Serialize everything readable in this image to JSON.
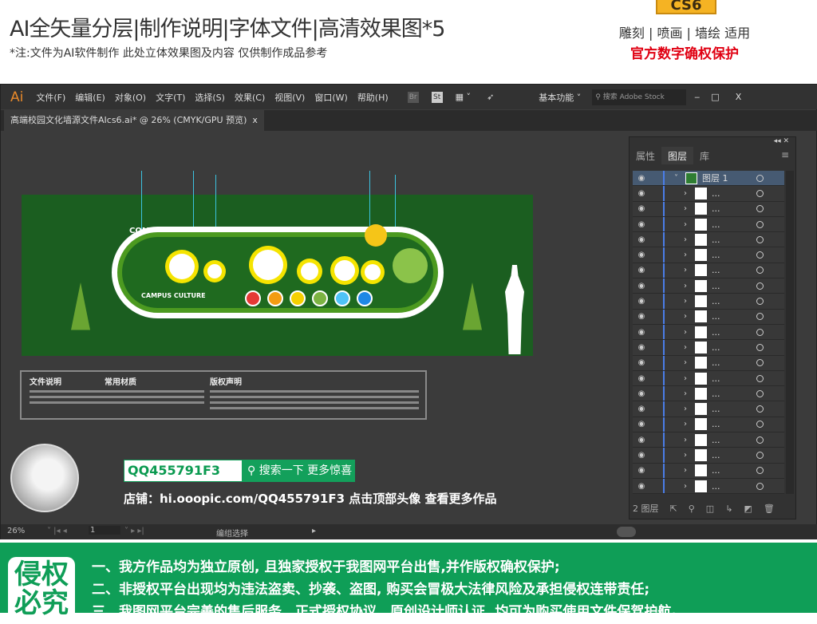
{
  "header": {
    "title": "AI全矢量分层|制作说明|字体文件|高清效果图*5",
    "subtitle": "*注:文件为AI软件制作 此处立体效果图及内容 仅供制作成品参考",
    "badge": "CS6",
    "usage": "雕刻 | 喷画 | 墙绘 适用",
    "protect": "官方数字确权保护"
  },
  "app": {
    "logo": "Ai",
    "menu": [
      "文件(F)",
      "编辑(E)",
      "对象(O)",
      "文字(T)",
      "选择(S)",
      "效果(C)",
      "视图(V)",
      "窗口(W)",
      "帮助(H)"
    ],
    "br": "Br",
    "st": "St",
    "workspace": "基本功能",
    "search_placeholder": "搜索 Adobe Stock",
    "minimize": "‒",
    "maximize": "□",
    "close": "X"
  },
  "document": {
    "tab": "高端校园文化墙源文件AIcs6.ai* @ 26% (CMYK/GPU 预览)",
    "tab_close": "x"
  },
  "artwork": {
    "logo": "COMPANY LOGO",
    "campus": "CAMPUS CULTURE",
    "badge_colors": [
      "#e53935",
      "#f39c12",
      "#f5d000",
      "#7cb342",
      "#4fc3f7",
      "#1e88e5"
    ],
    "info_headers": [
      "文件说明",
      "常用材质",
      "版权声明"
    ]
  },
  "promo": {
    "qq": "QQ455791F3",
    "search_button": "搜索一下 更多惊喜",
    "shop": "店铺：hi.ooopic.com/QQ455791F3   点击顶部头像 查看更多作品"
  },
  "layers_panel": {
    "tabs": [
      "属性",
      "图层",
      "库"
    ],
    "active_tab": "图层",
    "top_layer": "图层 1",
    "sublayer_label": "...",
    "sublayer_count": 20,
    "footer_count": "2 图层"
  },
  "status": {
    "zoom": "26%",
    "page": "1",
    "mode": "编组选择"
  },
  "footer": {
    "stamp": "侵权必究",
    "lines": [
      "一、我方作品均为独立原创, 且独家授权于我图网平台出售,并作版权确权保护;",
      "二、非授权平台出现均为违法盗卖、抄袭、盗图, 购买会冒极大法律风险及承担侵权连带责任;",
      "三、我图网平台完善的售后服务、正式授权协议、原创设计师认证, 均可为购买使用文件保驾护航。"
    ]
  }
}
